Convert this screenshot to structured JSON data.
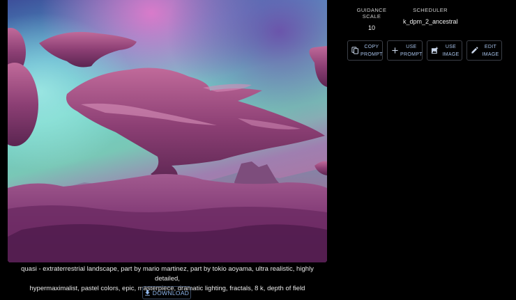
{
  "image": {
    "alt_icon": "generated-landscape-image"
  },
  "caption": {
    "line1": "quasi - extraterrestrial landscape, part by mario martinez, part by tokio aoyama, ultra realistic, highly detailed,",
    "line2": "hypermaximalist, pastel colors, epic, masterpiece, dramatic lighting, fractals, 8 k, depth of field"
  },
  "download": {
    "label": "DOWNLOAD",
    "icon": "download-icon"
  },
  "params": {
    "guidance_scale": {
      "name": "GUIDANCE SCALE",
      "value": "10"
    },
    "scheduler": {
      "name": "SCHEDULER",
      "value": "k_dpm_2_ancestral"
    }
  },
  "actions": [
    {
      "line1": "COPY",
      "line2": "PROMPT",
      "icon": "copy-icon"
    },
    {
      "line1": "USE",
      "line2": "PROMPT",
      "icon": "plus-icon"
    },
    {
      "line1": "USE",
      "line2": "IMAGE",
      "icon": "add-image-icon"
    },
    {
      "line1": "EDIT",
      "line2": "IMAGE",
      "icon": "pencil-icon"
    }
  ],
  "colors": {
    "background": "#000000",
    "accent": "#90b8ee",
    "text": "#e9e9e9"
  }
}
